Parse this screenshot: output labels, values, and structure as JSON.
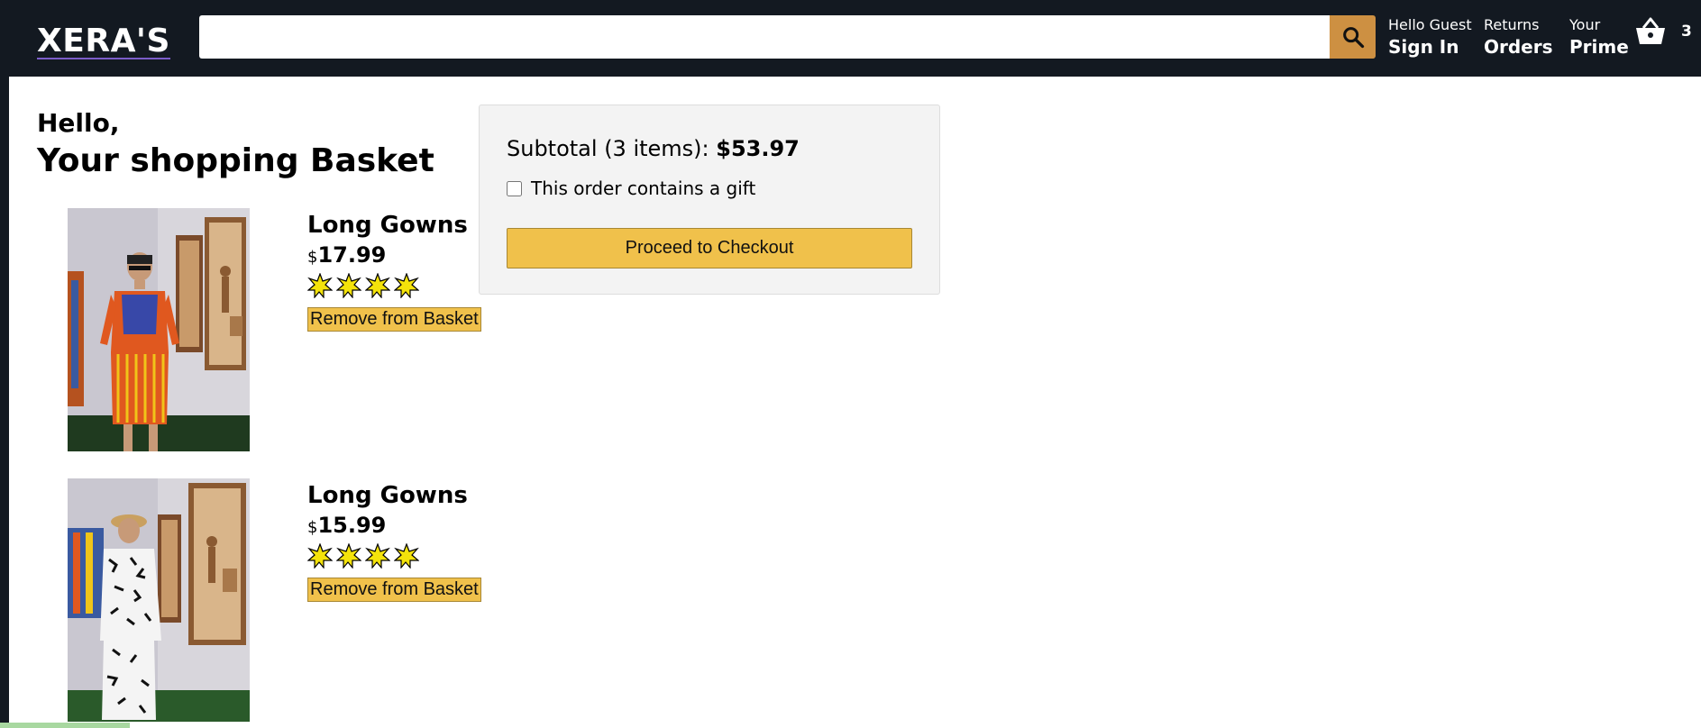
{
  "header": {
    "logo": "XERA'S",
    "search": {
      "value": "",
      "placeholder": ""
    },
    "nav": [
      {
        "line1": "Hello Guest",
        "line2": "Sign In"
      },
      {
        "line1": "Returns",
        "line2": "Orders"
      },
      {
        "line1": "Your",
        "line2": "Prime"
      }
    ],
    "basket_count": "3"
  },
  "checkout": {
    "hello": "Hello,",
    "title": "Your shopping Basket"
  },
  "products": [
    {
      "title": "Long Gowns",
      "currency": "$",
      "price": "17.99",
      "rating": 4,
      "remove_label": "Remove from Basket",
      "image_desc": "mannequin-orange-print-dress"
    },
    {
      "title": "Long Gowns",
      "currency": "$",
      "price": "15.99",
      "rating": 4,
      "remove_label": "Remove from Basket",
      "image_desc": "mannequin-black-white-print-outfit"
    }
  ],
  "subtotal": {
    "label": "Subtotal (3 items):",
    "amount": "$53.97",
    "gift_label": "This order contains a gift",
    "gift_checked": false,
    "checkout_label": "Proceed to Checkout"
  },
  "colors": {
    "header_bg": "#131921",
    "search_button": "#cd9042",
    "button_yellow": "#f0c14b",
    "star": "#f4e30b"
  }
}
